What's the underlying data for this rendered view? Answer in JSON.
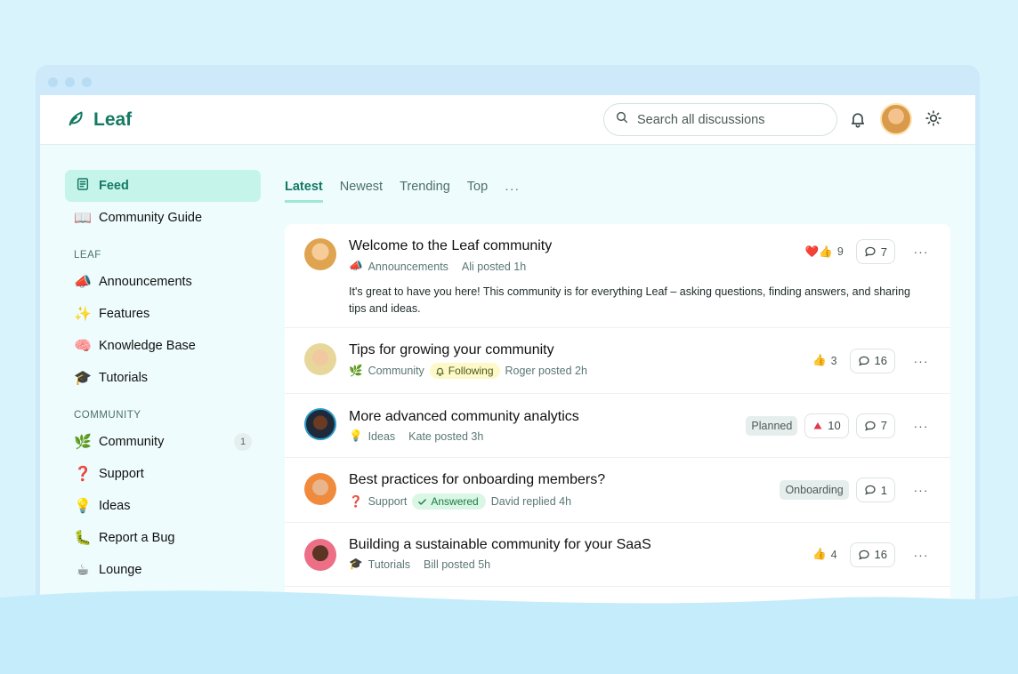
{
  "app": {
    "name": "Leaf",
    "brand_color": "#137a63"
  },
  "header": {
    "search_placeholder": "Search all discussions",
    "icons": [
      "leaf-icon",
      "search-icon",
      "bell-icon",
      "user-avatar",
      "sun-icon"
    ]
  },
  "sidebar": {
    "top": [
      {
        "label": "Feed",
        "icon": "feed-icon",
        "active": true
      },
      {
        "label": "Community Guide",
        "icon": "📖"
      }
    ],
    "sections": [
      {
        "title": "LEAF",
        "items": [
          {
            "label": "Announcements",
            "icon": "📣"
          },
          {
            "label": "Features",
            "icon": "✨"
          },
          {
            "label": "Knowledge Base",
            "icon": "🧠"
          },
          {
            "label": "Tutorials",
            "icon": "🎓"
          }
        ]
      },
      {
        "title": "COMMUNITY",
        "items": [
          {
            "label": "Community",
            "icon": "🌿",
            "count": "1"
          },
          {
            "label": "Support",
            "icon": "❓"
          },
          {
            "label": "Ideas",
            "icon": "💡"
          },
          {
            "label": "Report a Bug",
            "icon": "🐛"
          },
          {
            "label": "Lounge",
            "icon": "☕"
          }
        ]
      }
    ]
  },
  "tabs": [
    {
      "label": "Latest",
      "active": true
    },
    {
      "label": "Newest"
    },
    {
      "label": "Trending"
    },
    {
      "label": "Top"
    }
  ],
  "tabs_more": "···",
  "posts": [
    {
      "title": "Welcome to the Leaf community",
      "category": "Announcements",
      "category_icon": "📣",
      "byline": "Ali posted 1h",
      "body": "It's great to have you here! This community is for everything Leaf – asking questions, finding answers, and sharing tips and ideas.",
      "reactions": "❤️👍",
      "reaction_count": "9",
      "comments": "7"
    },
    {
      "title": "Tips for growing your community",
      "category": "Community",
      "category_icon": "🌿",
      "badge": "Following",
      "byline": "Roger posted 2h",
      "reactions": "👍",
      "reaction_count": "3",
      "comments": "16"
    },
    {
      "title": "More advanced community analytics",
      "category": "Ideas",
      "category_icon": "💡",
      "byline": "Kate posted 3h",
      "tag": "Planned",
      "upvotes": "10",
      "comments": "7"
    },
    {
      "title": "Best practices for onboarding members?",
      "category": "Support",
      "category_icon": "❓",
      "badge": "Answered",
      "byline": "David replied 4h",
      "tag": "Onboarding",
      "comments": "1"
    },
    {
      "title": "Building a sustainable community for your SaaS",
      "category": "Tutorials",
      "category_icon": "🎓",
      "byline": "Bill posted 5h",
      "reactions": "👍",
      "reaction_count": "4",
      "comments": "16"
    }
  ],
  "more_label": "···"
}
